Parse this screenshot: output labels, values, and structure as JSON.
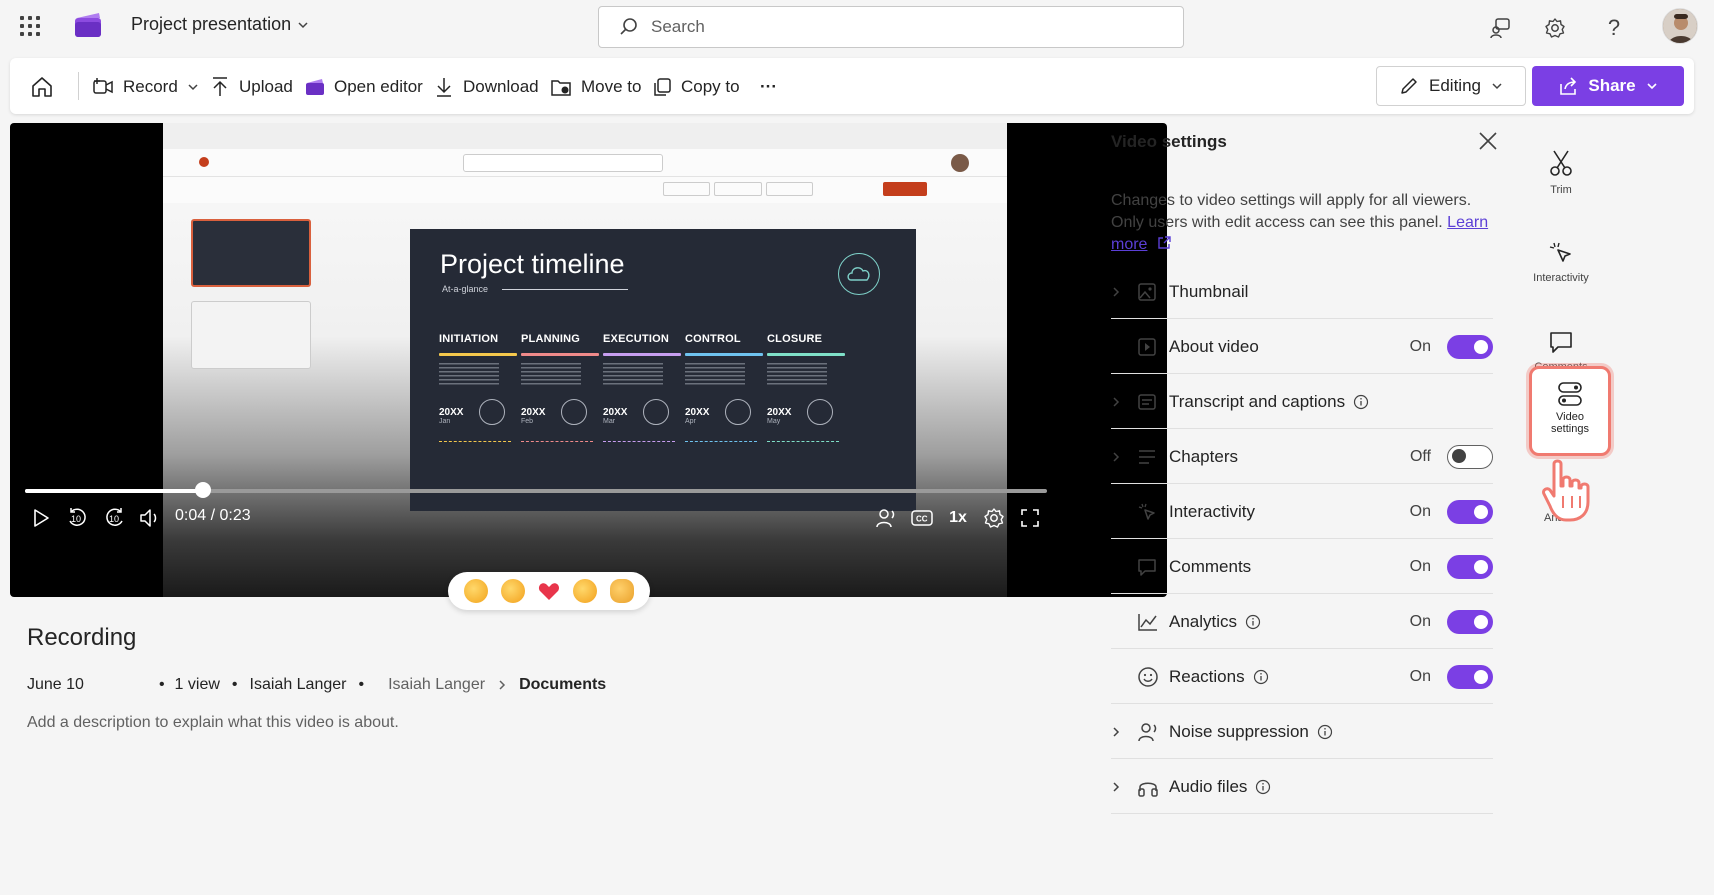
{
  "app": {
    "title": "Project presentation"
  },
  "search": {
    "placeholder": "Search"
  },
  "toolbar": {
    "record": "Record",
    "upload": "Upload",
    "open_editor": "Open editor",
    "download": "Download",
    "move_to": "Move to",
    "copy_to": "Copy to",
    "more": "···",
    "editing": "Editing",
    "share": "Share"
  },
  "slide": {
    "title": "Project timeline",
    "subtitle": "At-a-glance",
    "phases": [
      {
        "name": "INITIATION",
        "year": "20XX",
        "month": "Jan",
        "color": "#f5c84c"
      },
      {
        "name": "PLANNING",
        "year": "20XX",
        "month": "Feb",
        "color": "#f08a8a"
      },
      {
        "name": "EXECUTION",
        "year": "20XX",
        "month": "Mar",
        "color": "#c79ef0"
      },
      {
        "name": "CONTROL",
        "year": "20XX",
        "month": "Apr",
        "color": "#6fc3f0"
      },
      {
        "name": "CLOSURE",
        "year": "20XX",
        "month": "May",
        "color": "#7fe0c8"
      }
    ]
  },
  "player": {
    "time": "0:04 / 0:23",
    "progress": 0.174,
    "speed": "1x",
    "skip_back": "10",
    "skip_forward": "10"
  },
  "video": {
    "title": "Recording",
    "date": "June 10",
    "views": "1 view",
    "owner": "Isaiah Langer",
    "breadcrumb_owner": "Isaiah Langer",
    "breadcrumb_folder": "Documents",
    "description_placeholder": "Add a description to explain what this video is about."
  },
  "settings": {
    "title": "Video settings",
    "description": "Changes to video settings will apply for all viewers. Only users with edit access can see this panel.",
    "learn": "Learn",
    "more": "more",
    "rows": [
      {
        "label": "Thumbnail",
        "expandable": true
      },
      {
        "label": "About video",
        "value": "On"
      },
      {
        "label": "Transcript and captions",
        "expandable": true,
        "info": true
      },
      {
        "label": "Chapters",
        "expandable": true,
        "value": "Off"
      },
      {
        "label": "Interactivity",
        "value": "On"
      },
      {
        "label": "Comments",
        "value": "On"
      },
      {
        "label": "Analytics",
        "value": "On",
        "info": true
      },
      {
        "label": "Reactions",
        "value": "On",
        "info": true
      },
      {
        "label": "Noise suppression",
        "expandable": true,
        "info": true
      },
      {
        "label": "Audio files",
        "expandable": true,
        "info": true
      }
    ]
  },
  "rail": {
    "trim": "Trim",
    "interactivity": "Interactivity",
    "comments": "Comments",
    "video_settings": "Video settings",
    "analytics": "Ana"
  },
  "colors": {
    "accent": "#7b3fe4",
    "highlight": "#f07a70"
  }
}
